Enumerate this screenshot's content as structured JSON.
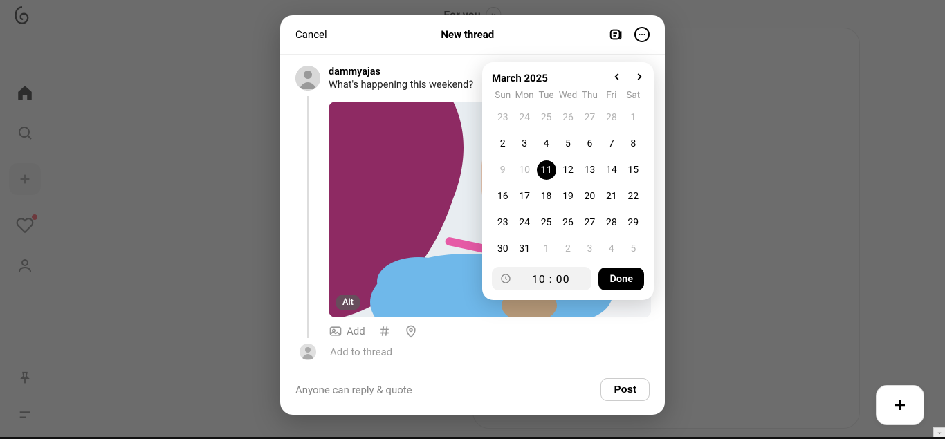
{
  "app": {
    "top_tab": "For you"
  },
  "sidebar": {
    "icons": [
      "home",
      "search",
      "create",
      "activity",
      "profile"
    ],
    "bottom_icons": [
      "pin",
      "menu"
    ]
  },
  "modal": {
    "cancel": "Cancel",
    "title": "New thread",
    "username": "dammyajas",
    "prompt": "What's happening this weekend?",
    "alt_badge": "Alt",
    "add_label": "Add",
    "add_to_thread": "Add to thread",
    "reply_label": "Anyone can reply & quote",
    "post_label": "Post"
  },
  "calendar": {
    "title": "March 2025",
    "dow": [
      "Sun",
      "Mon",
      "Tue",
      "Wed",
      "Thu",
      "Fri",
      "Sat"
    ],
    "weeks": [
      [
        {
          "d": "23",
          "dim": true
        },
        {
          "d": "24",
          "dim": true
        },
        {
          "d": "25",
          "dim": true
        },
        {
          "d": "26",
          "dim": true
        },
        {
          "d": "27",
          "dim": true
        },
        {
          "d": "28",
          "dim": true
        },
        {
          "d": "1",
          "dim": true
        }
      ],
      [
        {
          "d": "2"
        },
        {
          "d": "3"
        },
        {
          "d": "4"
        },
        {
          "d": "5"
        },
        {
          "d": "6"
        },
        {
          "d": "7"
        },
        {
          "d": "8"
        }
      ],
      [
        {
          "d": "9",
          "dim": true
        },
        {
          "d": "10",
          "dim": true
        },
        {
          "d": "11",
          "sel": true
        },
        {
          "d": "12"
        },
        {
          "d": "13"
        },
        {
          "d": "14"
        },
        {
          "d": "15"
        }
      ],
      [
        {
          "d": "16"
        },
        {
          "d": "17"
        },
        {
          "d": "18"
        },
        {
          "d": "19"
        },
        {
          "d": "20"
        },
        {
          "d": "21"
        },
        {
          "d": "22"
        }
      ],
      [
        {
          "d": "23"
        },
        {
          "d": "24"
        },
        {
          "d": "25"
        },
        {
          "d": "26"
        },
        {
          "d": "27"
        },
        {
          "d": "28"
        },
        {
          "d": "29"
        }
      ],
      [
        {
          "d": "30"
        },
        {
          "d": "31"
        },
        {
          "d": "1",
          "dim": true
        },
        {
          "d": "2",
          "dim": true
        },
        {
          "d": "3",
          "dim": true
        },
        {
          "d": "4",
          "dim": true
        },
        {
          "d": "5",
          "dim": true
        }
      ]
    ],
    "time": "10 : 00",
    "done": "Done"
  }
}
